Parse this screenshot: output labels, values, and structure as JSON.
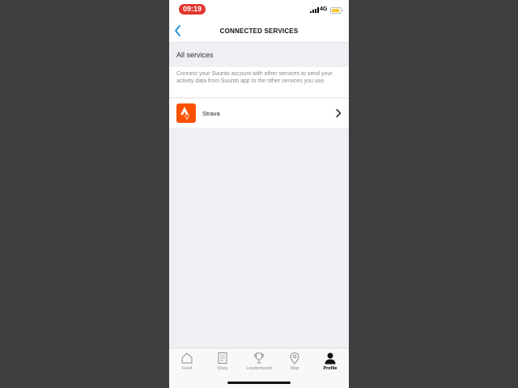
{
  "status_bar": {
    "time": "09:19",
    "network": "4G",
    "time_pill_color": "#e0362c",
    "battery_color": "#f5c82e",
    "battery_level": 0.85
  },
  "header": {
    "title": "CONNECTED SERVICES",
    "back_icon": "chevron-left-icon",
    "accent_color": "#1a8fd6"
  },
  "section": {
    "title": "All services",
    "description": "Connect your Suunto account with other services to send your activity data from Suunto app to the other services you use."
  },
  "services": [
    {
      "label": "Strava",
      "icon": "strava-logo-icon",
      "brand_color": "#fc5200"
    }
  ],
  "tab_bar": {
    "tabs": [
      {
        "label": "Feed",
        "icon": "home-icon",
        "active": false
      },
      {
        "label": "Diary",
        "icon": "diary-icon",
        "active": false
      },
      {
        "label": "Leaderboard",
        "icon": "trophy-icon",
        "active": false
      },
      {
        "label": "Map",
        "icon": "map-pin-icon",
        "active": false
      },
      {
        "label": "Profile",
        "icon": "profile-icon",
        "active": true
      }
    ]
  }
}
